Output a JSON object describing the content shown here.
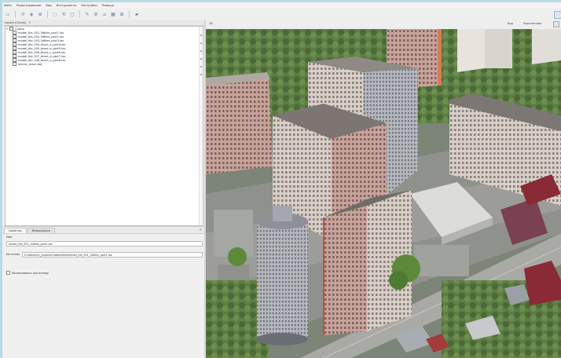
{
  "menu": [
    "Файл",
    "Редактирование",
    "Вид",
    "Инструменты",
    "Настройки",
    "Помощь"
  ],
  "toolbar_icons": [
    "new-icon",
    "open-icon",
    "save-icon",
    "zoom-icon",
    "select-icon",
    "rotate-icon",
    "measure-icon",
    "layer-icon",
    "settings-icon",
    "help-icon",
    "grid-icon",
    "image-icon"
  ],
  "left_panel": {
    "title": "Layers (Chunk)",
    "tree_root": "Сцена",
    "tree_items": [
      "model_tile_001.3dtiles_part1.las",
      "model_tile_002.3dtiles_part2.las",
      "model_tile_003.3dtiles_part3.las",
      "model_tile_004_block_a_part4.las",
      "model_tile_005_block_b_part5.las",
      "model_tile_006_block_c_part6.las",
      "model_tile_007_block_d_part7.las",
      "model_tile_008_block_e_part8.las",
      "terrain_mesh.obj"
    ]
  },
  "props_panel": {
    "tabs": [
      "Свойства",
      "Информация"
    ],
    "name_label": "Имя",
    "name_value": "model_tile_001_3dtiles_part1.las",
    "path_label": "Источник",
    "path_value": "D:/data/city_project/models/tiles/model_tile_001_3dtiles_part1.las",
    "checkbox_label": "Использовать как основу"
  },
  "view": {
    "left_label": "3D",
    "right_label_1": "Вид",
    "right_label_2": "Перспектива"
  }
}
